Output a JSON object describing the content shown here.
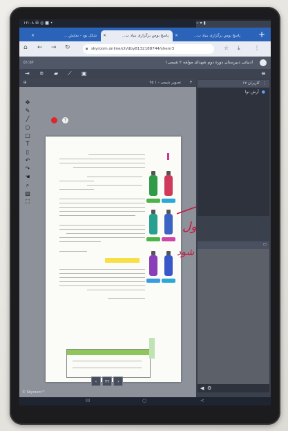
{
  "status_bar": {
    "left": "۱۲:۰۸ ☰ ◎ ■ •",
    "right": "⌁ ▾ ▮"
  },
  "browser": {
    "tabs": [
      {
        "label": "پاسخ بوس برگزاری بنیاد ب...",
        "active": false
      },
      {
        "label": "پاسخ بوس برگزاری بنیاد ب...",
        "active": true
      },
      {
        "label": "شکل بود - نمایش ...",
        "active": false
      }
    ],
    "new_tab": "+",
    "url": "skyroom.online/ch/dby8132188744/shenr3",
    "back_icon": "arrow-left-icon",
    "forward_icon": "arrow-right-icon",
    "reload_icon": "reload-icon"
  },
  "skyroom": {
    "clock": "۵۱:۵۶",
    "room_title": "ادبیاتی دبیرستان دوره دوم شهدای مولفه ۲ شیمی۱",
    "board_title": "تصویر شیمی - ۱ ۲۵",
    "board_number": "۳",
    "left_panel_title": "کاربران ۱۲",
    "user_name": "آرش نوا",
    "page_number": "۳۲",
    "logo": "© Skyroom™",
    "tools": [
      "move-icon",
      "pen-icon",
      "line-icon",
      "circle-icon",
      "rectangle-icon",
      "text-icon",
      "eraser-icon",
      "undo-icon",
      "redo-icon",
      "hand-icon",
      "zoom-icon",
      "image-icon",
      "fullscreen-icon"
    ]
  },
  "handwriting": {
    "line1": "درعناصرقطعاًاول",
    "line2": "تعبیرشیمی انجام شود",
    "ink_color": "#c8143c"
  },
  "android_nav": {
    "recent": "III",
    "home": "○",
    "back": "<"
  }
}
